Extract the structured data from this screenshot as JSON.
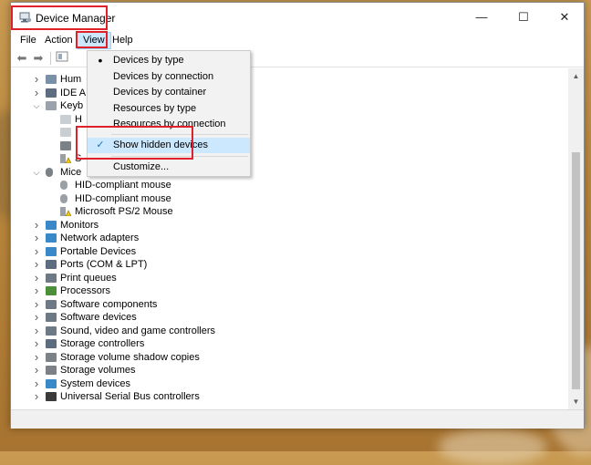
{
  "window": {
    "title": "Device Manager"
  },
  "window_controls": {
    "minimize": "—",
    "maximize": "☐",
    "close": "✕"
  },
  "menu": [
    "File",
    "Action",
    "View",
    "Help"
  ],
  "tree": [
    {
      "label": "Hum",
      "level": 1,
      "expander": "collapsed",
      "icon": "hid-icon",
      "color": "#7a8fa8"
    },
    {
      "label": "IDE A",
      "level": 1,
      "expander": "collapsed",
      "icon": "ide-icon",
      "color": "#5b6d7e"
    },
    {
      "label": "Keyb",
      "level": 1,
      "expander": "expanded",
      "icon": "keyboard-icon",
      "color": "#9aa3ab"
    },
    {
      "label": "H",
      "level": 2,
      "expander": "none",
      "icon": "keyboard-icon",
      "color": "#c9ced2"
    },
    {
      "label": "",
      "level": 2,
      "expander": "none",
      "icon": "keyboard-icon",
      "color": "#c9ced2"
    },
    {
      "label": "",
      "level": 2,
      "expander": "none",
      "icon": "keyboard-icon",
      "color": "#7b8187"
    },
    {
      "label": "S",
      "level": 2,
      "expander": "none",
      "icon": "warning-icon",
      "color": "#d9a400"
    },
    {
      "label": "Mice",
      "level": 1,
      "expander": "expanded",
      "icon": "mouse-icon",
      "color": "#7b8187"
    },
    {
      "label": "HID-compliant mouse",
      "level": 2,
      "expander": "none",
      "icon": "mouse-icon",
      "color": "#9aa0a6"
    },
    {
      "label": "HID-compliant mouse",
      "level": 2,
      "expander": "none",
      "icon": "mouse-icon",
      "color": "#9aa0a6"
    },
    {
      "label": "Microsoft PS/2 Mouse",
      "level": 2,
      "expander": "none",
      "icon": "warning-icon",
      "color": "#d9a400"
    },
    {
      "label": "Monitors",
      "level": 1,
      "expander": "collapsed",
      "icon": "monitor-icon",
      "color": "#3a88c8"
    },
    {
      "label": "Network adapters",
      "level": 1,
      "expander": "collapsed",
      "icon": "network-icon",
      "color": "#3a88c8"
    },
    {
      "label": "Portable Devices",
      "level": 1,
      "expander": "collapsed",
      "icon": "portable-device-icon",
      "color": "#3a88c8"
    },
    {
      "label": "Ports (COM & LPT)",
      "level": 1,
      "expander": "collapsed",
      "icon": "port-icon",
      "color": "#5b6d7e"
    },
    {
      "label": "Print queues",
      "level": 1,
      "expander": "collapsed",
      "icon": "printer-icon",
      "color": "#6d7a86"
    },
    {
      "label": "Processors",
      "level": 1,
      "expander": "collapsed",
      "icon": "processor-icon",
      "color": "#4b8f3a"
    },
    {
      "label": "Software components",
      "level": 1,
      "expander": "collapsed",
      "icon": "software-component-icon",
      "color": "#6d7a86"
    },
    {
      "label": "Software devices",
      "level": 1,
      "expander": "collapsed",
      "icon": "software-device-icon",
      "color": "#6d7a86"
    },
    {
      "label": "Sound, video and game controllers",
      "level": 1,
      "expander": "collapsed",
      "icon": "speaker-icon",
      "color": "#6d7a86"
    },
    {
      "label": "Storage controllers",
      "level": 1,
      "expander": "collapsed",
      "icon": "storage-controller-icon",
      "color": "#5b6d7e"
    },
    {
      "label": "Storage volume shadow copies",
      "level": 1,
      "expander": "collapsed",
      "icon": "disk-icon",
      "color": "#7b8187"
    },
    {
      "label": "Storage volumes",
      "level": 1,
      "expander": "collapsed",
      "icon": "disk-icon",
      "color": "#7b8187"
    },
    {
      "label": "System devices",
      "level": 1,
      "expander": "collapsed",
      "icon": "system-device-icon",
      "color": "#3a88c8"
    },
    {
      "label": "Universal Serial Bus controllers",
      "level": 1,
      "expander": "collapsed",
      "icon": "usb-icon",
      "color": "#3a3a3a"
    }
  ],
  "view_menu": {
    "items": [
      {
        "label": "Devices by type",
        "mark": "•"
      },
      {
        "label": "Devices by connection",
        "mark": ""
      },
      {
        "label": "Devices by container",
        "mark": ""
      },
      {
        "label": "Resources by type",
        "mark": ""
      },
      {
        "label": "Resources by connection",
        "mark": ""
      },
      {
        "label": "Show hidden devices",
        "mark": "✓"
      },
      {
        "label": "Customize...",
        "mark": ""
      }
    ],
    "selected": "Show hidden devices"
  },
  "colors": {
    "highlight": "#cce8ff",
    "callout": "#e0202a",
    "accent": "#1a6fc4"
  }
}
